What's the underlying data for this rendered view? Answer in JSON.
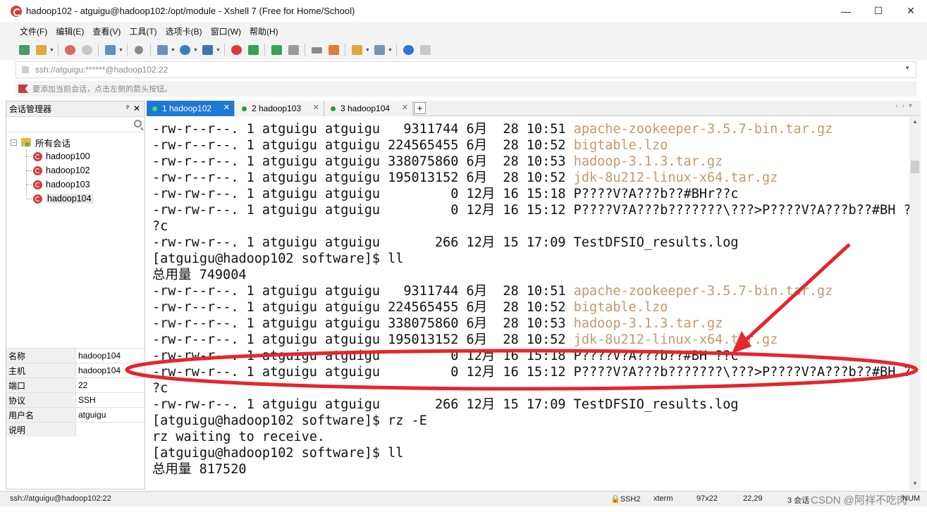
{
  "window": {
    "title": "hadoop102 - atguigu@hadoop102:/opt/module - Xshell 7 (Free for Home/School)",
    "minimize": "—",
    "maximize": "☐",
    "close": "✕"
  },
  "menu": [
    "文件(F)",
    "编辑(E)",
    "查看(V)",
    "工具(T)",
    "选项卡(B)",
    "窗口(W)",
    "帮助(H)"
  ],
  "address": {
    "value": "ssh://atguigu:******@hadoop102:22"
  },
  "hint": "要添加当前会话，点击左侧的箭头按钮。",
  "session_manager": {
    "title": "会话管理器",
    "pin": "ᵖ",
    "close": "✕",
    "root": "所有会话",
    "items": [
      "hadoop100",
      "hadoop102",
      "hadoop103",
      "hadoop104"
    ],
    "selected": "hadoop104"
  },
  "properties": [
    {
      "key": "名称",
      "value": "hadoop104"
    },
    {
      "key": "主机",
      "value": "hadoop104"
    },
    {
      "key": "端口",
      "value": "22"
    },
    {
      "key": "协议",
      "value": "SSH"
    },
    {
      "key": "用户名",
      "value": "atguigu"
    },
    {
      "key": "说明",
      "value": ""
    }
  ],
  "tabs": [
    {
      "label": "1 hadoop102",
      "active": true
    },
    {
      "label": "2 hadoop103",
      "active": false
    },
    {
      "label": "3 hadoop104",
      "active": false
    }
  ],
  "tab_add": "+",
  "terminal": {
    "lines": [
      {
        "prefix": "-rw-r--r--. 1 atguigu atguigu   9311744 6月  28 10:51 ",
        "file": "apache-zookeeper-3.5.7-bin.tar.gz"
      },
      {
        "prefix": "-rw-r--r--. 1 atguigu atguigu 224565455 6月  28 10:52 ",
        "file": "bigtable.lzo"
      },
      {
        "prefix": "-rw-r--r--. 1 atguigu atguigu 338075860 6月  28 10:53 ",
        "file": "hadoop-3.1.3.tar.gz"
      },
      {
        "prefix": "-rw-r--r--. 1 atguigu atguigu 195013152 6月  28 10:52 ",
        "file": "jdk-8u212-linux-x64.tar.gz"
      },
      {
        "prefix": "-rw-rw-r--. 1 atguigu atguigu         0 12月 16 15:18 P????V?A???b??#BHr??c",
        "file": ""
      },
      {
        "prefix": "-rw-rw-r--. 1 atguigu atguigu         0 12月 16 15:12 P????V?A???b???????\\???>P????V?A???b??#BH ?",
        "file": ""
      },
      {
        "prefix": "?c",
        "file": ""
      },
      {
        "prefix": "-rw-rw-r--. 1 atguigu atguigu       266 12月 15 17:09 TestDFSIO_results.log",
        "file": ""
      },
      {
        "prefix": "[atguigu@hadoop102 software]$ ll",
        "file": ""
      },
      {
        "prefix": "总用量 749004",
        "file": ""
      },
      {
        "prefix": "-rw-r--r--. 1 atguigu atguigu   9311744 6月  28 10:51 ",
        "file": "apache-zookeeper-3.5.7-bin.tar.gz"
      },
      {
        "prefix": "-rw-r--r--. 1 atguigu atguigu 224565455 6月  28 10:52 ",
        "file": "bigtable.lzo"
      },
      {
        "prefix": "-rw-r--r--. 1 atguigu atguigu 338075860 6月  28 10:53 ",
        "file": "hadoop-3.1.3.tar.gz"
      },
      {
        "prefix": "-rw-r--r--. 1 atguigu atguigu 195013152 6月  28 10:52 ",
        "file": "jdk-8u212-linux-x64.tar.gz"
      },
      {
        "prefix": "-rw-rw-r--. 1 atguigu atguigu         0 12月 16 15:18 P????V?A???b??#BH ??c",
        "file": ""
      },
      {
        "prefix": "-rw-rw-r--. 1 atguigu atguigu         0 12月 16 15:12 P????V?A???b???????\\???>P????V?A???b??#BH ?",
        "file": ""
      },
      {
        "prefix": "?c",
        "file": ""
      },
      {
        "prefix": "-rw-rw-r--. 1 atguigu atguigu       266 12月 15 17:09 TestDFSIO_results.log",
        "file": ""
      },
      {
        "prefix": "[atguigu@hadoop102 software]$ rz -E",
        "file": ""
      },
      {
        "prefix": "rz waiting to receive.",
        "file": ""
      },
      {
        "prefix": "[atguigu@hadoop102 software]$ ll",
        "file": ""
      },
      {
        "prefix": "总用量 817520",
        "file": ""
      }
    ]
  },
  "status": {
    "connection": "ssh://atguigu@hadoop102:22",
    "protocol": "SSH2",
    "term": "xterm",
    "size": "97x22",
    "cursor": "22,29",
    "sessions": "3 会话",
    "watermark": "CSDN @阿祥不吃肉",
    "caps": "NUM"
  },
  "colors": {
    "active_tab": "#1e78d6",
    "filename": "#c4996b",
    "annotation_red": "#e5262c"
  }
}
